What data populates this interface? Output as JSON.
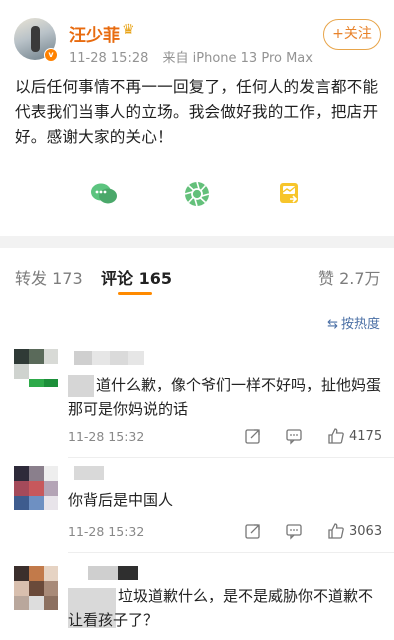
{
  "post": {
    "username": "汪少菲",
    "crown_glyph": "♛",
    "verified_glyph": "v",
    "time": "11-28 15:28",
    "source": "来自 iPhone 13 Pro Max",
    "follow_label": "+关注",
    "text": "以后任何事情不再一一回复了，任何人的发言都不能代表我们当事人的立场。我会做好我的工作，把店开好。感谢大家的关心！",
    "actions": [
      "share-icon",
      "comment-icon",
      "like-icon"
    ]
  },
  "tabs": {
    "repost": "转发 173",
    "comments": "评论 165",
    "likes": "赞 2.7万"
  },
  "sort": {
    "icon": "⇆",
    "label": "按热度"
  },
  "comments": [
    {
      "text": "道什么歉，像个爷们一样不好吗，扯他妈蛋 那可是你妈说的话",
      "time": "11-28 15:32",
      "likes": "4175"
    },
    {
      "text": "你背后是中国人",
      "time": "11-28 15:32",
      "likes": "3063"
    },
    {
      "text": "垃圾道歉什么，是不是威胁你不道歉不让看孩子了？",
      "time": "",
      "likes": ""
    }
  ],
  "colors": {
    "accent": "#ff8a00",
    "username": "#e86b0f",
    "sort": "#4a6fa5"
  }
}
